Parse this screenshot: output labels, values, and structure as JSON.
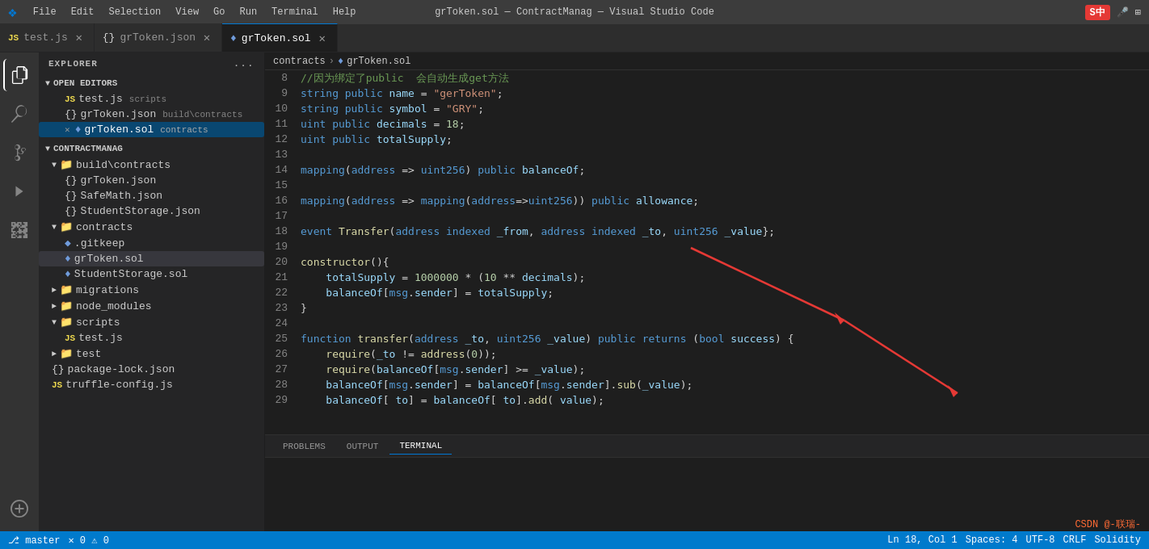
{
  "titlebar": {
    "logo": "VS",
    "menus": [
      "File",
      "Edit",
      "Selection",
      "View",
      "Go",
      "Run",
      "Terminal",
      "Help"
    ],
    "title": "grToken.sol — ContractManag — Visual Studio Code",
    "sogou": "S中",
    "mic_icon": "🎤",
    "grid_icon": "⊞"
  },
  "tabs": [
    {
      "id": "test-js",
      "icon_type": "js",
      "label": "test.js",
      "active": false,
      "dirty": false
    },
    {
      "id": "grtoken-json",
      "icon_type": "json",
      "label": "grToken.json",
      "active": false,
      "dirty": false
    },
    {
      "id": "grtoken-sol",
      "icon_type": "sol",
      "label": "grToken.sol",
      "active": true,
      "dirty": false
    }
  ],
  "breadcrumb": {
    "contracts": "contracts",
    "separator": ">",
    "file": "grToken.sol"
  },
  "sidebar": {
    "title": "EXPLORER",
    "dots": "...",
    "sections": {
      "open_editors": {
        "label": "OPEN EDITORS",
        "items": [
          {
            "icon": "js",
            "name": "test.js",
            "path": "scripts",
            "indent": 2
          },
          {
            "icon": "json",
            "name": "grToken.json",
            "path": "build\\contracts",
            "indent": 2
          },
          {
            "icon": "sol",
            "name": "grToken.sol",
            "path": "contracts",
            "indent": 2,
            "active": true,
            "close": true
          }
        ]
      },
      "contractmanag": {
        "label": "CONTRACTMANAG",
        "children": [
          {
            "type": "folder",
            "name": "build\\contracts",
            "expanded": true,
            "indent": 1,
            "children": [
              {
                "icon": "json",
                "name": "grToken.json",
                "indent": 2
              },
              {
                "icon": "json",
                "name": "SafeMath.json",
                "indent": 2
              },
              {
                "icon": "json",
                "name": "StudentStorage.json",
                "indent": 2
              }
            ]
          },
          {
            "type": "folder",
            "name": "contracts",
            "expanded": true,
            "indent": 1,
            "children": [
              {
                "icon": "git",
                "name": ".gitkeep",
                "indent": 2
              },
              {
                "icon": "sol",
                "name": "grToken.sol",
                "indent": 2,
                "active": true
              },
              {
                "icon": "sol",
                "name": "StudentStorage.sol",
                "indent": 2
              }
            ]
          },
          {
            "type": "folder",
            "name": "migrations",
            "expanded": false,
            "indent": 1
          },
          {
            "type": "folder",
            "name": "node_modules",
            "expanded": false,
            "indent": 1
          },
          {
            "type": "folder",
            "name": "scripts",
            "expanded": true,
            "indent": 1,
            "children": [
              {
                "icon": "js",
                "name": "test.js",
                "indent": 2
              }
            ]
          },
          {
            "type": "folder",
            "name": "test",
            "expanded": false,
            "indent": 1
          },
          {
            "icon": "json",
            "name": "package-lock.json",
            "indent": 1
          },
          {
            "icon": "js",
            "name": "truffle-config.js",
            "indent": 1
          }
        ]
      }
    }
  },
  "code_lines": [
    {
      "num": 8,
      "tokens": [
        {
          "t": "comment",
          "v": "//因为绑定了public  会自动生成get方法"
        }
      ]
    },
    {
      "num": 9,
      "tokens": [
        {
          "t": "kw",
          "v": "string"
        },
        {
          "t": "plain",
          "v": " "
        },
        {
          "t": "kw",
          "v": "public"
        },
        {
          "t": "plain",
          "v": " "
        },
        {
          "t": "var",
          "v": "name"
        },
        {
          "t": "plain",
          "v": " = "
        },
        {
          "t": "str",
          "v": "\"gerToken\""
        },
        {
          "t": "plain",
          "v": ";"
        }
      ]
    },
    {
      "num": 10,
      "tokens": [
        {
          "t": "kw",
          "v": "string"
        },
        {
          "t": "plain",
          "v": " "
        },
        {
          "t": "kw",
          "v": "public"
        },
        {
          "t": "plain",
          "v": " "
        },
        {
          "t": "var",
          "v": "symbol"
        },
        {
          "t": "plain",
          "v": " = "
        },
        {
          "t": "str",
          "v": "\"GRY\""
        },
        {
          "t": "plain",
          "v": ";"
        }
      ]
    },
    {
      "num": 11,
      "tokens": [
        {
          "t": "kw",
          "v": "uint"
        },
        {
          "t": "plain",
          "v": " "
        },
        {
          "t": "kw",
          "v": "public"
        },
        {
          "t": "plain",
          "v": " "
        },
        {
          "t": "var",
          "v": "decimals"
        },
        {
          "t": "plain",
          "v": " = "
        },
        {
          "t": "num",
          "v": "18"
        },
        {
          "t": "plain",
          "v": ";"
        }
      ]
    },
    {
      "num": 12,
      "tokens": [
        {
          "t": "kw",
          "v": "uint"
        },
        {
          "t": "plain",
          "v": " "
        },
        {
          "t": "kw",
          "v": "public"
        },
        {
          "t": "plain",
          "v": " "
        },
        {
          "t": "var",
          "v": "totalSupply"
        },
        {
          "t": "plain",
          "v": ";"
        }
      ]
    },
    {
      "num": 13,
      "tokens": []
    },
    {
      "num": 14,
      "tokens": [
        {
          "t": "kw",
          "v": "mapping"
        },
        {
          "t": "plain",
          "v": "("
        },
        {
          "t": "kw",
          "v": "address"
        },
        {
          "t": "plain",
          "v": " => "
        },
        {
          "t": "kw",
          "v": "uint256"
        },
        {
          "t": "plain",
          "v": ") "
        },
        {
          "t": "kw",
          "v": "public"
        },
        {
          "t": "plain",
          "v": " "
        },
        {
          "t": "var",
          "v": "balanceOf"
        },
        {
          "t": "plain",
          "v": ";"
        }
      ]
    },
    {
      "num": 15,
      "tokens": []
    },
    {
      "num": 16,
      "tokens": [
        {
          "t": "kw",
          "v": "mapping"
        },
        {
          "t": "plain",
          "v": "("
        },
        {
          "t": "kw",
          "v": "address"
        },
        {
          "t": "plain",
          "v": " => "
        },
        {
          "t": "kw",
          "v": "mapping"
        },
        {
          "t": "plain",
          "v": "("
        },
        {
          "t": "kw",
          "v": "address"
        },
        {
          "t": "plain",
          "v": "=>"
        },
        {
          "t": "kw",
          "v": "uint256"
        },
        {
          "t": "plain",
          "v": ")) "
        },
        {
          "t": "kw",
          "v": "public"
        },
        {
          "t": "plain",
          "v": " "
        },
        {
          "t": "var",
          "v": "allowance"
        },
        {
          "t": "plain",
          "v": ";"
        }
      ]
    },
    {
      "num": 17,
      "tokens": []
    },
    {
      "num": 18,
      "tokens": [
        {
          "t": "kw",
          "v": "event"
        },
        {
          "t": "plain",
          "v": " "
        },
        {
          "t": "fn",
          "v": "Transfer"
        },
        {
          "t": "plain",
          "v": "("
        },
        {
          "t": "kw",
          "v": "address"
        },
        {
          "t": "plain",
          "v": " "
        },
        {
          "t": "kw",
          "v": "indexed"
        },
        {
          "t": "plain",
          "v": " "
        },
        {
          "t": "var",
          "v": "_from"
        },
        {
          "t": "plain",
          "v": ", "
        },
        {
          "t": "kw",
          "v": "address"
        },
        {
          "t": "plain",
          "v": " "
        },
        {
          "t": "kw",
          "v": "indexed"
        },
        {
          "t": "plain",
          "v": " "
        },
        {
          "t": "var",
          "v": "_to"
        },
        {
          "t": "plain",
          "v": ", "
        },
        {
          "t": "kw",
          "v": "uint256"
        },
        {
          "t": "plain",
          "v": " "
        },
        {
          "t": "var",
          "v": "_value"
        },
        {
          "t": "plain",
          "v": "};"
        }
      ]
    },
    {
      "num": 19,
      "tokens": []
    },
    {
      "num": 20,
      "tokens": [
        {
          "t": "fn",
          "v": "constructor"
        },
        {
          "t": "plain",
          "v": "(){"
        }
      ]
    },
    {
      "num": 21,
      "tokens": [
        {
          "t": "plain",
          "v": "    "
        },
        {
          "t": "var",
          "v": "totalSupply"
        },
        {
          "t": "plain",
          "v": " = "
        },
        {
          "t": "num",
          "v": "1000000"
        },
        {
          "t": "plain",
          "v": " * ("
        },
        {
          "t": "num",
          "v": "10"
        },
        {
          "t": "plain",
          "v": " ** "
        },
        {
          "t": "var",
          "v": "decimals"
        },
        {
          "t": "plain",
          "v": ");"
        }
      ]
    },
    {
      "num": 22,
      "tokens": [
        {
          "t": "plain",
          "v": "    "
        },
        {
          "t": "var",
          "v": "balanceOf"
        },
        {
          "t": "plain",
          "v": "["
        },
        {
          "t": "kw",
          "v": "msg"
        },
        {
          "t": "plain",
          "v": "."
        },
        {
          "t": "var",
          "v": "sender"
        },
        {
          "t": "plain",
          "v": "] = "
        },
        {
          "t": "var",
          "v": "totalSupply"
        },
        {
          "t": "plain",
          "v": ";"
        }
      ]
    },
    {
      "num": 23,
      "tokens": [
        {
          "t": "plain",
          "v": "}"
        }
      ]
    },
    {
      "num": 24,
      "tokens": []
    },
    {
      "num": 25,
      "tokens": [
        {
          "t": "kw",
          "v": "function"
        },
        {
          "t": "plain",
          "v": " "
        },
        {
          "t": "fn",
          "v": "transfer"
        },
        {
          "t": "plain",
          "v": "("
        },
        {
          "t": "kw",
          "v": "address"
        },
        {
          "t": "plain",
          "v": " "
        },
        {
          "t": "var",
          "v": "_to"
        },
        {
          "t": "plain",
          "v": ", "
        },
        {
          "t": "kw",
          "v": "uint256"
        },
        {
          "t": "plain",
          "v": " "
        },
        {
          "t": "var",
          "v": "_value"
        },
        {
          "t": "plain",
          "v": ") "
        },
        {
          "t": "kw",
          "v": "public"
        },
        {
          "t": "plain",
          "v": " "
        },
        {
          "t": "kw",
          "v": "returns"
        },
        {
          "t": "plain",
          "v": " ("
        },
        {
          "t": "kw",
          "v": "bool"
        },
        {
          "t": "plain",
          "v": " "
        },
        {
          "t": "var",
          "v": "success"
        },
        {
          "t": "plain",
          "v": ") {"
        }
      ]
    },
    {
      "num": 26,
      "tokens": [
        {
          "t": "plain",
          "v": "    "
        },
        {
          "t": "fn",
          "v": "require"
        },
        {
          "t": "plain",
          "v": "("
        },
        {
          "t": "var",
          "v": "_to"
        },
        {
          "t": "plain",
          "v": " != "
        },
        {
          "t": "fn",
          "v": "address"
        },
        {
          "t": "plain",
          "v": "("
        },
        {
          "t": "num",
          "v": "0"
        },
        {
          "t": "plain",
          "v": "));"
        }
      ]
    },
    {
      "num": 27,
      "tokens": [
        {
          "t": "plain",
          "v": "    "
        },
        {
          "t": "fn",
          "v": "require"
        },
        {
          "t": "plain",
          "v": "("
        },
        {
          "t": "var",
          "v": "balanceOf"
        },
        {
          "t": "plain",
          "v": "["
        },
        {
          "t": "kw",
          "v": "msg"
        },
        {
          "t": "plain",
          "v": "."
        },
        {
          "t": "var",
          "v": "sender"
        },
        {
          "t": "plain",
          "v": "] >= "
        },
        {
          "t": "var",
          "v": "_value"
        },
        {
          "t": "plain",
          "v": ");"
        }
      ]
    },
    {
      "num": 28,
      "tokens": [
        {
          "t": "plain",
          "v": "    "
        },
        {
          "t": "var",
          "v": "balanceOf"
        },
        {
          "t": "plain",
          "v": "["
        },
        {
          "t": "kw",
          "v": "msg"
        },
        {
          "t": "plain",
          "v": "."
        },
        {
          "t": "var",
          "v": "sender"
        },
        {
          "t": "plain",
          "v": "] = "
        },
        {
          "t": "var",
          "v": "balanceOf"
        },
        {
          "t": "plain",
          "v": "["
        },
        {
          "t": "kw",
          "v": "msg"
        },
        {
          "t": "plain",
          "v": "."
        },
        {
          "t": "var",
          "v": "sender"
        },
        {
          "t": "plain",
          "v": "]."
        },
        {
          "t": "fn",
          "v": "sub"
        },
        {
          "t": "plain",
          "v": "("
        },
        {
          "t": "var",
          "v": "_value"
        },
        {
          "t": "plain",
          "v": ");"
        }
      ]
    },
    {
      "num": 29,
      "tokens": [
        {
          "t": "plain",
          "v": "    "
        },
        {
          "t": "var",
          "v": "balanceOf"
        },
        {
          "t": "plain",
          "v": "[ "
        },
        {
          "t": "var",
          "v": "to"
        },
        {
          "t": "plain",
          "v": "] = "
        },
        {
          "t": "var",
          "v": "balanceOf"
        },
        {
          "t": "plain",
          "v": "[ "
        },
        {
          "t": "var",
          "v": "to"
        },
        {
          "t": "plain",
          "v": "]."
        },
        {
          "t": "fn",
          "v": "add"
        },
        {
          "t": "plain",
          "v": "( "
        },
        {
          "t": "var",
          "v": "value"
        },
        {
          "t": "plain",
          "v": ");"
        }
      ]
    }
  ],
  "panel": {
    "tabs": [
      "PROBLEMS",
      "OUTPUT",
      "TERMINAL"
    ],
    "active_tab": "TERMINAL"
  },
  "status_bar": {
    "branch": "master",
    "errors": "0",
    "warnings": "0",
    "ln": "Ln 18, Col 1",
    "spaces": "Spaces: 4",
    "encoding": "UTF-8",
    "line_ending": "CRLF",
    "lang": "Solidity",
    "csdn": "CSDN @-联瑞-"
  },
  "colors": {
    "accent_blue": "#007acc",
    "active_bg": "#094771",
    "tab_active_border": "#0078d4"
  }
}
